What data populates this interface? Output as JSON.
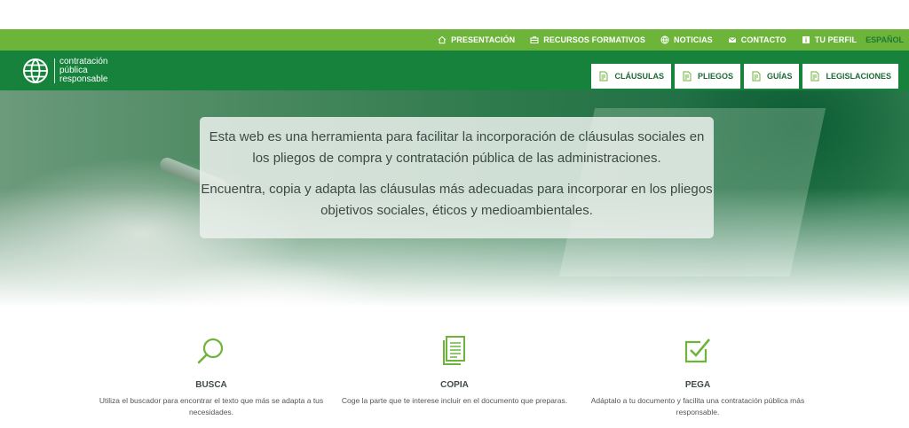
{
  "topnav": {
    "items": [
      {
        "label": "PRESENTACIÓN",
        "icon": "home-icon"
      },
      {
        "label": "RECURSOS FORMATIVOS",
        "icon": "briefcase-icon"
      },
      {
        "label": "NOTICIAS",
        "icon": "globe-icon"
      },
      {
        "label": "CONTACTO",
        "icon": "mail-icon"
      },
      {
        "label": "TU PERFIL",
        "icon": "user-info-icon"
      }
    ],
    "language": "ESPAÑOL"
  },
  "brand": {
    "line1": "contratación",
    "line2": "pública",
    "line3": "responsable"
  },
  "tabs": [
    {
      "label": "CLÁUSULAS",
      "icon": "document-icon"
    },
    {
      "label": "PLIEGOS",
      "icon": "document-icon"
    },
    {
      "label": "GUÍAS",
      "icon": "document-icon"
    },
    {
      "label": "LEGISLACIONES",
      "icon": "document-icon"
    }
  ],
  "hero": {
    "paragraph1": "Esta web es una herramienta para facilitar la incorporación de cláusulas sociales en los pliegos de compra y contratación pública de las administraciones.",
    "paragraph2": "Encuentra, copia y adapta las cláusulas más adecuadas para incorporar en los pliegos objetivos sociales, éticos y medioambientales."
  },
  "features": [
    {
      "title": "BUSCA",
      "desc": "Utiliza el buscador para encontrar el texto que más se adapta a tus necesidades.",
      "icon": "search-icon"
    },
    {
      "title": "COPIA",
      "desc": "Coge la parte que te interese incluir en el documento que preparas.",
      "icon": "copy-document-icon"
    },
    {
      "title": "PEGA",
      "desc": "Adáptalo a tu documento y facilita una contratación pública más responsable.",
      "icon": "checkbox-icon"
    }
  ],
  "colors": {
    "topbar": "#6db53a",
    "header": "#16823c",
    "accent": "#6db53a"
  }
}
